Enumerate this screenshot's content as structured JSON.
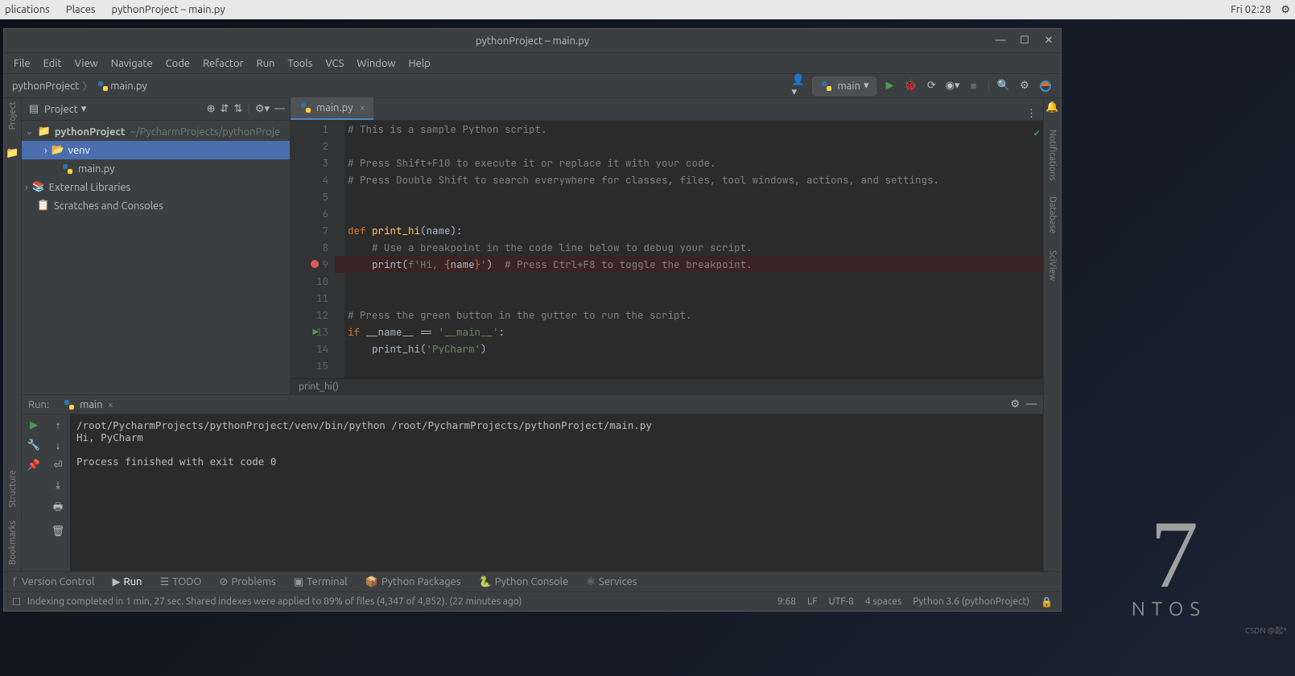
{
  "os_bar": {
    "items": [
      "plications",
      "Places",
      "pythonProject – main.py"
    ],
    "clock": "Fri 02:28"
  },
  "window": {
    "title": "pythonProject – main.py"
  },
  "menubar": [
    "File",
    "Edit",
    "View",
    "Navigate",
    "Code",
    "Refactor",
    "Run",
    "Tools",
    "VCS",
    "Window",
    "Help"
  ],
  "nav": {
    "breadcrumb": [
      "pythonProject",
      "main.py"
    ],
    "run_config": "main"
  },
  "project": {
    "header": "Project",
    "root": "pythonProject",
    "root_path": "~/PycharmProjects/pythonProje",
    "items": [
      {
        "label": "venv",
        "type": "folder",
        "selected": true,
        "indent": 1,
        "arrow": true
      },
      {
        "label": "main.py",
        "type": "pyfile",
        "indent": 2
      },
      {
        "label": "External Libraries",
        "type": "lib",
        "indent": 0,
        "arrow": true
      },
      {
        "label": "Scratches and Consoles",
        "type": "scratch",
        "indent": 0
      }
    ]
  },
  "editor": {
    "tab": "main.py",
    "breadcrumb": "print_hi()",
    "lines": [
      {
        "n": 1
      },
      {
        "n": 2
      },
      {
        "n": 3
      },
      {
        "n": 4
      },
      {
        "n": 5
      },
      {
        "n": 6
      },
      {
        "n": 7
      },
      {
        "n": 8
      },
      {
        "n": 9,
        "bp": true
      },
      {
        "n": 10
      },
      {
        "n": 11
      },
      {
        "n": 12
      },
      {
        "n": 13,
        "run": true
      },
      {
        "n": 14
      },
      {
        "n": 15
      }
    ],
    "code": {
      "l1_cm": "# This is a sample Python script.",
      "l3_cm": "# Press Shift+F10 to execute it or replace it with your code.",
      "l4_cm": "# Press Double Shift to search everywhere for classes, files, tool windows, actions, and settings.",
      "l7_kw": "def ",
      "l7_fn": "print_hi",
      "l7_rest": "(name):",
      "l8_cm": "    # Use a breakpoint in the code line below to debug your script.",
      "l9_fn": "    print",
      "l9_p1": "(",
      "l9_s1": "f'Hi, ",
      "l9_t1": "{",
      "l9_v": "name",
      "l9_t2": "}",
      "l9_s2": "'",
      "l9_p2": ")  ",
      "l9_cm": "# Press Ctrl+F8 to toggle the breakpoint.",
      "l12_cm": "# Press the green button in the gutter to run the script.",
      "l13_kw": "if ",
      "l13_n": "__name__ == ",
      "l13_s": "'__main__'",
      "l13_c": ":",
      "l14_fn": "    print_hi",
      "l14_p1": "(",
      "l14_s": "'PyCharm'",
      "l14_p2": ")"
    }
  },
  "run": {
    "label": "Run:",
    "tab": "main",
    "output_l1": "/root/PycharmProjects/pythonProject/venv/bin/python /root/PycharmProjects/pythonProject/main.py",
    "output_l2": "Hi, PyCharm",
    "output_l3": "",
    "output_l4": "Process finished with exit code 0"
  },
  "bottom_tools": [
    "Version Control",
    "Run",
    "TODO",
    "Problems",
    "Terminal",
    "Python Packages",
    "Python Console",
    "Services"
  ],
  "statusbar": {
    "msg": "Indexing completed in 1 min, 27 sec. Shared indexes were applied to 89% of files (4,347 of 4,852). (22 minutes ago)",
    "pos": "9:68",
    "lf": "LF",
    "enc": "UTF-8",
    "indent": "4 spaces",
    "interp": "Python 3.6 (pythonProject)"
  },
  "right_tools": [
    "Notifications",
    "Database",
    "SciView"
  ],
  "left_tools": [
    "Project",
    "Structure",
    "Bookmarks"
  ],
  "desktop": {
    "big": "7",
    "word": "NTOS",
    "watermark": "CSDN @起*"
  }
}
